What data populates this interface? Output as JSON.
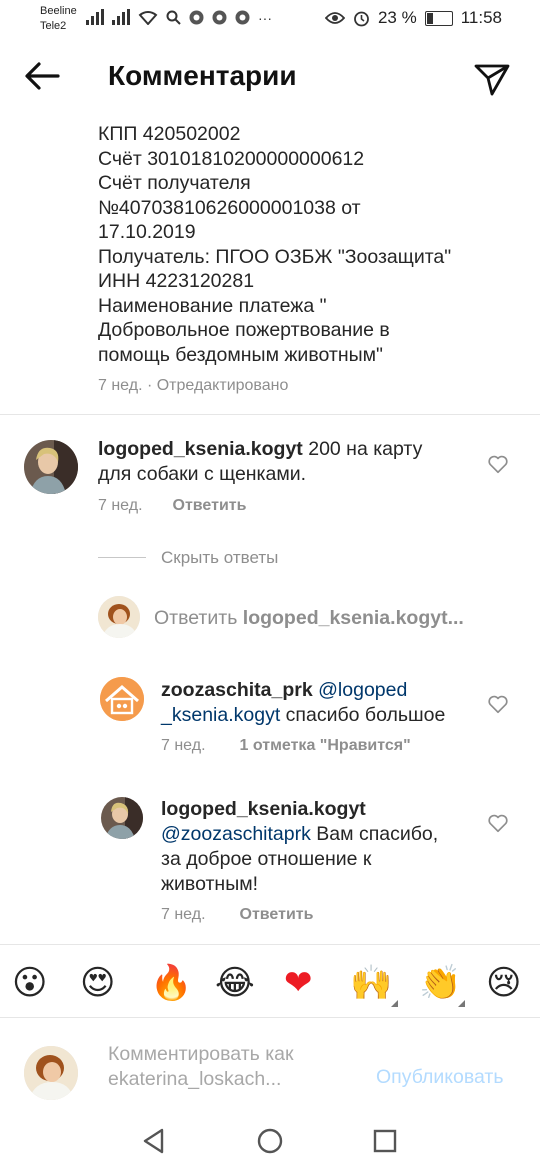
{
  "status_bar": {
    "carrier1": "Beeline",
    "carrier2": "Tele2",
    "battery": "23 %",
    "time": "11:58"
  },
  "header": {
    "title": "Комментарии",
    "back_icon": "arrow-left-icon",
    "send_icon": "paper-plane-icon"
  },
  "caption": {
    "lines": [
      "КПП 420502002",
      "Счёт 30101810200000000612",
      "Счёт получателя",
      "№40703810626000001038 от",
      "17.10.2019",
      "Получатель: ПГОО ОЗБЖ \"Зоозащита\"",
      "ИНН 4223120281",
      "Наименование платежа \"",
      "Добровольное пожертвование в",
      "помощь бездомным животным\""
    ],
    "meta": "7 нед. · Отредактировано"
  },
  "comment": {
    "username": "logoped_ksenia.kogyt",
    "text_line1": " 200 на карту",
    "text_line2": "для собаки с щенками.",
    "time": "7 нед.",
    "reply_label": "Ответить"
  },
  "hide_replies": "Скрыть ответы",
  "reply_input": {
    "prefix": "Ответить ",
    "target": "logoped_ksenia.kogyt..."
  },
  "replies": [
    {
      "username": "zoozaschita_prk",
      "mention_part1": "@logoped",
      "mention_part2": "_ksenia.kogyt",
      "text": " спасибо большое",
      "time": "7 нед.",
      "likes": "1 отметка \"Нравится\""
    },
    {
      "username": "logoped_ksenia.kogyt",
      "mention": "@zoozaschitaprk",
      "text_line1": " Вам спасибо,",
      "text_line2": "за доброе отношение к",
      "text_line3": "животным!",
      "time": "7 нед.",
      "reply_label": "Ответить"
    }
  ],
  "reactions": [
    "😮",
    "😍",
    "🔥",
    "😂",
    "❤",
    "🙌",
    "👏",
    "😢"
  ],
  "composer": {
    "placeholder_line1": "Комментировать как",
    "placeholder_line2": "ekaterina_loskach...",
    "publish_label": "Опубликовать"
  },
  "colors": {
    "text": "#262626",
    "muted": "#8e8e8e",
    "mention": "#00376b",
    "publish_disabled": "#b3dbff",
    "heart_red": "#ed1c24"
  }
}
